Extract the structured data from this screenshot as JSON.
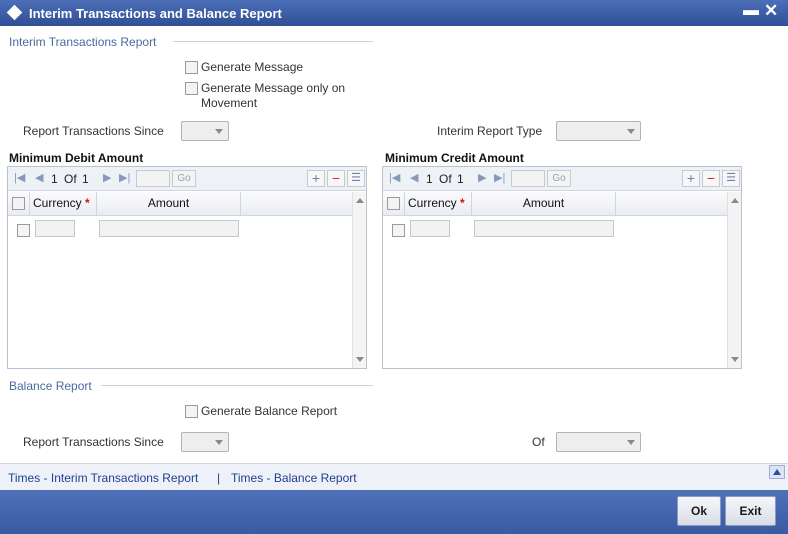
{
  "window": {
    "title": "Interim Transactions and Balance Report",
    "minimize": "▬",
    "close": "✕"
  },
  "interim": {
    "section_title": "Interim Transactions Report",
    "generate_message": "Generate Message",
    "generate_message_movement_line1": "Generate Message only on",
    "generate_message_movement_line2": "Movement",
    "report_since_label": "Report Transactions Since",
    "report_type_label": "Interim Report Type"
  },
  "debit_grid": {
    "title": "Minimum Debit Amount",
    "page": "1",
    "of_label": "Of",
    "total": "1",
    "go": "Go",
    "col_currency": "Currency",
    "col_amount": "Amount",
    "required": "*"
  },
  "credit_grid": {
    "title": "Minimum Credit Amount",
    "page": "1",
    "of_label": "Of",
    "total": "1",
    "go": "Go",
    "col_currency": "Currency",
    "col_amount": "Amount",
    "required": "*"
  },
  "balance": {
    "section_title": "Balance Report",
    "generate_balance": "Generate Balance Report",
    "report_since_label": "Report Transactions Since",
    "of_label": "Of"
  },
  "links": {
    "interim_link": "Times - Interim Transactions Report",
    "separator": "|",
    "balance_link": "Times - Balance Report"
  },
  "buttons": {
    "ok": "Ok",
    "exit": "Exit"
  }
}
